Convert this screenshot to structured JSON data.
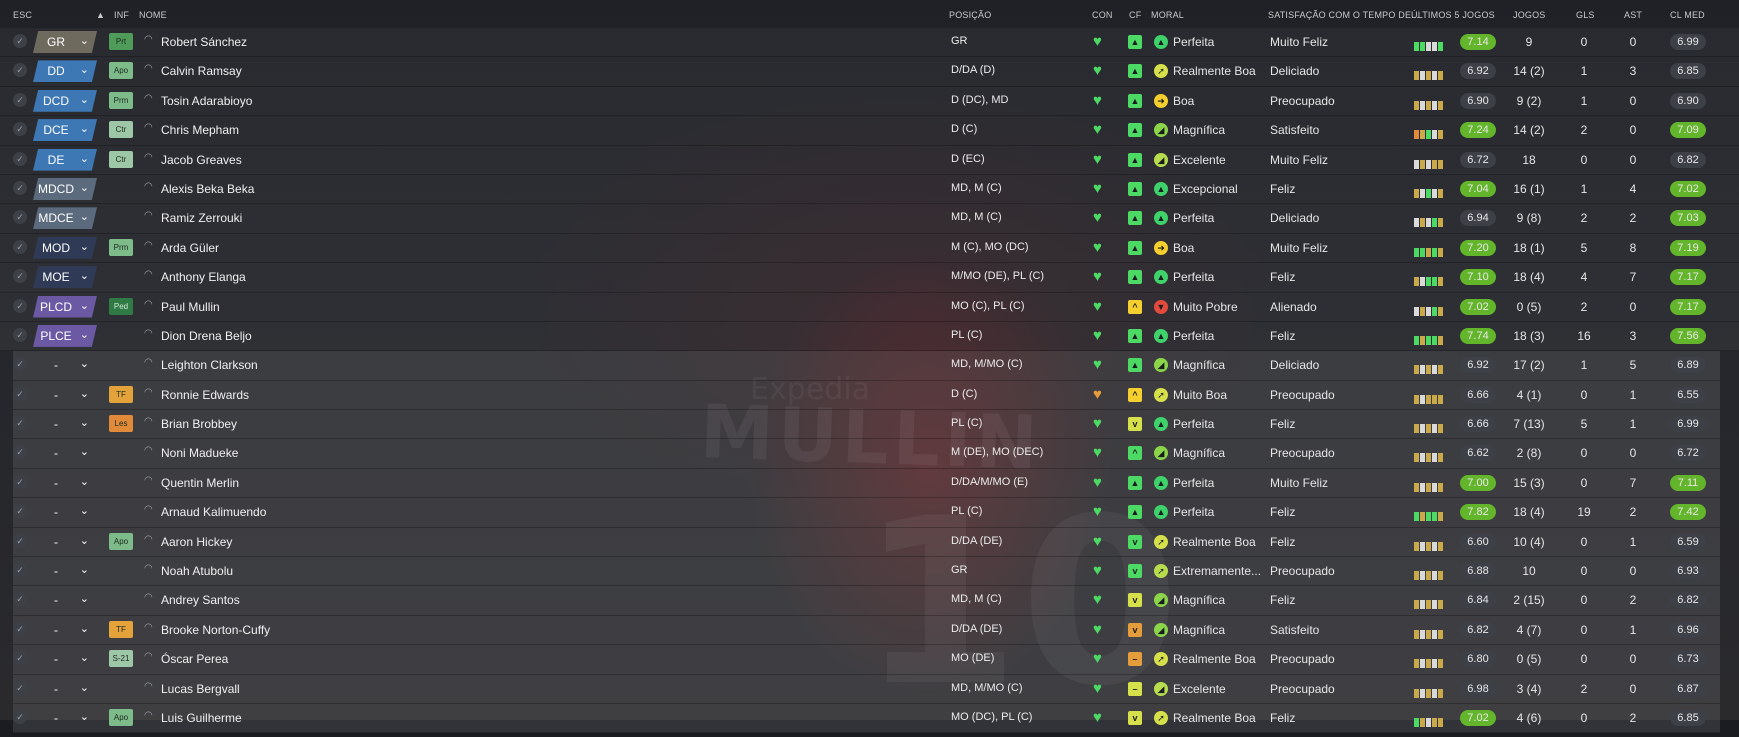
{
  "headers": {
    "esc": "ESC",
    "inf": "INF",
    "nome": "NOME",
    "posicao": "POSIÇÃO",
    "con": "CON",
    "cf": "CF",
    "moral": "MORAL",
    "satisfacao": "SATISFAÇÃO COM O TEMPO DE...",
    "ultimos": "ÚLTIMOS 5 JOGOS",
    "jogos": "JOGOS",
    "gls": "GLS",
    "ast": "AST",
    "clmed": "CL MED"
  },
  "background_text": {
    "shirt_name": "MULLIN",
    "shirt_number": "10",
    "sponsor": "Expedia"
  },
  "colors": {
    "gk": "#6f6a5e",
    "def": "#3d78b5",
    "mid": "#5b6b7d",
    "dm": "#2f3b56",
    "att": "#6b5aa3",
    "rating_high": "#63b52b",
    "rating_low": "#3d4047",
    "heart": "#4cd964",
    "heart_warn": "#e59c3a"
  },
  "players": [
    {
      "pos": "GR",
      "pcol": "gk",
      "inf": "Prt",
      "infc": "#4f9c5a",
      "name": "Robert Sánchez",
      "posicao": "GR",
      "heart": "ok",
      "cf": "▲",
      "cfc": "#4cd964",
      "mico": "▲",
      "mc": "#3fd16a",
      "moral": "Perfeita",
      "sat": "Muito Feliz",
      "bars": [
        "#4cd964",
        "#4cd964",
        "#d9d9d9",
        "#d9d9d9",
        "#4cd964"
      ],
      "rating": "7.14",
      "rh": true,
      "jogos": "9",
      "gls": "0",
      "ast": "0",
      "cl": "6.99",
      "ch": false
    },
    {
      "pos": "DD",
      "pcol": "def",
      "inf": "Apo",
      "infc": "#7dbb8a",
      "name": "Calvin Ramsay",
      "posicao": "D/DA (D)",
      "heart": "ok",
      "cf": "▲",
      "cfc": "#4cd964",
      "mico": "➚",
      "mc": "#d6e04a",
      "moral": "Realmente Boa",
      "sat": "Deliciado",
      "bars": [
        "#c9a94a",
        "#d9d9d9",
        "#c9a94a",
        "#d9d9d9",
        "#c9a94a"
      ],
      "rating": "6.92",
      "rh": false,
      "jogos": "14 (2)",
      "gls": "1",
      "ast": "3",
      "cl": "6.85",
      "ch": false
    },
    {
      "pos": "DCD",
      "pcol": "def",
      "inf": "Prm",
      "infc": "#7dbb8a",
      "name": "Tosin Adarabioyo",
      "posicao": "D (DC), MD",
      "heart": "ok",
      "cf": "▲",
      "cfc": "#4cd964",
      "mico": "➜",
      "mc": "#f4cf2d",
      "moral": "Boa",
      "sat": "Preocupado",
      "bars": [
        "#c9a94a",
        "#d9d9d9",
        "#c9a94a",
        "#d9d9d9",
        "#c9a94a"
      ],
      "rating": "6.90",
      "rh": false,
      "jogos": "9 (2)",
      "gls": "1",
      "ast": "0",
      "cl": "6.90",
      "ch": false
    },
    {
      "pos": "DCE",
      "pcol": "def",
      "inf": "Ctr",
      "infc": "#9ec7a7",
      "name": "Chris Mepham",
      "posicao": "D (C)",
      "heart": "ok",
      "cf": "▲",
      "cfc": "#4cd964",
      "mico": "◢",
      "mc": "#8bd54a",
      "moral": "Magnífica",
      "sat": "Satisfeito",
      "bars": [
        "#e08a3a",
        "#c9a94a",
        "#4cd964",
        "#d9d9d9",
        "#c9a94a"
      ],
      "rating": "7.24",
      "rh": true,
      "jogos": "14 (2)",
      "gls": "2",
      "ast": "0",
      "cl": "7.09",
      "ch": true
    },
    {
      "pos": "DE",
      "pcol": "def",
      "inf": "Ctr",
      "infc": "#9ec7a7",
      "name": "Jacob Greaves",
      "posicao": "D (EC)",
      "heart": "ok",
      "cf": "▲",
      "cfc": "#4cd964",
      "mico": "◢",
      "mc": "#b7dd4e",
      "moral": "Excelente",
      "sat": "Muito Feliz",
      "bars": [
        "#d9d9d9",
        "#c9a94a",
        "#d9d9d9",
        "#c9a94a",
        "#c9a94a"
      ],
      "rating": "6.72",
      "rh": false,
      "jogos": "18",
      "gls": "0",
      "ast": "0",
      "cl": "6.82",
      "ch": false
    },
    {
      "pos": "MDCD",
      "pcol": "mid",
      "inf": "",
      "infc": "",
      "name": "Alexis Beka Beka",
      "posicao": "MD, M (C)",
      "heart": "ok",
      "cf": "▲",
      "cfc": "#4cd964",
      "mico": "▲",
      "mc": "#3fd16a",
      "moral": "Excepcional",
      "sat": "Feliz",
      "bars": [
        "#c9a94a",
        "#d9d9d9",
        "#4cd964",
        "#d9d9d9",
        "#c9a94a"
      ],
      "rating": "7.04",
      "rh": true,
      "jogos": "16 (1)",
      "gls": "1",
      "ast": "4",
      "cl": "7.02",
      "ch": true
    },
    {
      "pos": "MDCE",
      "pcol": "mid",
      "inf": "",
      "infc": "",
      "name": "Ramiz Zerrouki",
      "posicao": "MD, M (C)",
      "heart": "ok",
      "cf": "▲",
      "cfc": "#4cd964",
      "mico": "▲",
      "mc": "#3fd16a",
      "moral": "Perfeita",
      "sat": "Deliciado",
      "bars": [
        "#d9d9d9",
        "#c9a94a",
        "#d9d9d9",
        "#4cd964",
        "#c9a94a"
      ],
      "rating": "6.94",
      "rh": false,
      "jogos": "9 (8)",
      "gls": "2",
      "ast": "2",
      "cl": "7.03",
      "ch": true
    },
    {
      "pos": "MOD",
      "pcol": "dm",
      "inf": "Prm",
      "infc": "#7dbb8a",
      "name": "Arda Güler",
      "posicao": "M (C), MO (DC)",
      "heart": "ok",
      "cf": "▲",
      "cfc": "#4cd964",
      "mico": "➜",
      "mc": "#f4cf2d",
      "moral": "Boa",
      "sat": "Muito Feliz",
      "bars": [
        "#4cd964",
        "#4cd964",
        "#c9a94a",
        "#4cd964",
        "#c9a94a"
      ],
      "rating": "7.20",
      "rh": true,
      "jogos": "18 (1)",
      "gls": "5",
      "ast": "8",
      "cl": "7.19",
      "ch": true
    },
    {
      "pos": "MOE",
      "pcol": "dm",
      "inf": "",
      "infc": "",
      "name": "Anthony Elanga",
      "posicao": "M/MO (DE), PL (C)",
      "heart": "ok",
      "cf": "▲",
      "cfc": "#4cd964",
      "mico": "▲",
      "mc": "#3fd16a",
      "moral": "Perfeita",
      "sat": "Feliz",
      "bars": [
        "#c9a94a",
        "#d9d9d9",
        "#4cd964",
        "#4cd964",
        "#c9a94a"
      ],
      "rating": "7.10",
      "rh": true,
      "jogos": "18 (4)",
      "gls": "4",
      "ast": "7",
      "cl": "7.17",
      "ch": true
    },
    {
      "pos": "PLCD",
      "pcol": "att",
      "inf": "Ped",
      "infc": "#2f7a45",
      "name": "Paul Mullin",
      "posicao": "MO (C), PL (C)",
      "heart": "ok",
      "cf": "^",
      "cfc": "#f4cf2d",
      "mico": "▼",
      "mc": "#e24a3b",
      "moral": "Muito Pobre",
      "sat": "Alienado",
      "bars": [
        "#d9d9d9",
        "#c9a94a",
        "#d9d9d9",
        "#4cd964",
        "#c9a94a"
      ],
      "rating": "7.02",
      "rh": true,
      "jogos": "0 (5)",
      "gls": "2",
      "ast": "0",
      "cl": "7.17",
      "ch": true
    },
    {
      "pos": "PLCE",
      "pcol": "att",
      "inf": "",
      "infc": "",
      "name": "Dion Drena Beljo",
      "posicao": "PL (C)",
      "heart": "ok",
      "cf": "▲",
      "cfc": "#4cd964",
      "mico": "▲",
      "mc": "#3fd16a",
      "moral": "Perfeita",
      "sat": "Feliz",
      "bars": [
        "#4cd964",
        "#c9a94a",
        "#4cd964",
        "#4cd964",
        "#c9a94a"
      ],
      "rating": "7.74",
      "rh": true,
      "jogos": "18 (3)",
      "gls": "16",
      "ast": "3",
      "cl": "7.56",
      "ch": true
    },
    {
      "pos": "-",
      "pcol": "none",
      "inf": "",
      "infc": "",
      "name": "Leighton Clarkson",
      "posicao": "MD, M/MO (C)",
      "heart": "ok",
      "cf": "▲",
      "cfc": "#4cd964",
      "mico": "◢",
      "mc": "#8bd54a",
      "moral": "Magnífica",
      "sat": "Deliciado",
      "bars": [
        "#c9a94a",
        "#d9d9d9",
        "#c9a94a",
        "#d9d9d9",
        "#c9a94a"
      ],
      "rating": "6.92",
      "rh": false,
      "jogos": "17 (2)",
      "gls": "1",
      "ast": "5",
      "cl": "6.89",
      "ch": false
    },
    {
      "pos": "-",
      "pcol": "none",
      "inf": "TF",
      "infc": "#e3a33a",
      "name": "Ronnie Edwards",
      "posicao": "D (C)",
      "heart": "warn",
      "cf": "^",
      "cfc": "#f4cf2d",
      "mico": "➚",
      "mc": "#d6e04a",
      "moral": "Muito Boa",
      "sat": "Preocupado",
      "bars": [
        "#c9a94a",
        "#d9d9d9",
        "#c9a94a",
        "#c9a94a",
        "#c9a94a"
      ],
      "rating": "6.66",
      "rh": false,
      "jogos": "4 (1)",
      "gls": "0",
      "ast": "1",
      "cl": "6.55",
      "ch": false
    },
    {
      "pos": "-",
      "pcol": "none",
      "inf": "Les",
      "infc": "#e08a3a",
      "name": "Brian Brobbey",
      "posicao": "PL (C)",
      "heart": "ok",
      "cf": "v",
      "cfc": "#d6e04a",
      "mico": "▲",
      "mc": "#3fd16a",
      "moral": "Perfeita",
      "sat": "Feliz",
      "bars": [
        "#c9a94a",
        "#d9d9d9",
        "#c9a94a",
        "#d9d9d9",
        "#c9a94a"
      ],
      "rating": "6.66",
      "rh": false,
      "jogos": "7 (13)",
      "gls": "5",
      "ast": "1",
      "cl": "6.99",
      "ch": false
    },
    {
      "pos": "-",
      "pcol": "none",
      "inf": "",
      "infc": "",
      "name": "Noni Madueke",
      "posicao": "M (DE), MO (DEC)",
      "heart": "ok",
      "cf": "^",
      "cfc": "#4cd964",
      "mico": "◢",
      "mc": "#8bd54a",
      "moral": "Magnífica",
      "sat": "Preocupado",
      "bars": [
        "#c9a94a",
        "#d9d9d9",
        "#c9a94a",
        "#d9d9d9",
        "#c9a94a"
      ],
      "rating": "6.62",
      "rh": false,
      "jogos": "2 (8)",
      "gls": "0",
      "ast": "0",
      "cl": "6.72",
      "ch": false
    },
    {
      "pos": "-",
      "pcol": "none",
      "inf": "",
      "infc": "",
      "name": "Quentin Merlin",
      "posicao": "D/DA/M/MO (E)",
      "heart": "ok",
      "cf": "▲",
      "cfc": "#4cd964",
      "mico": "▲",
      "mc": "#3fd16a",
      "moral": "Perfeita",
      "sat": "Muito Feliz",
      "bars": [
        "#c9a94a",
        "#d9d9d9",
        "#c9a94a",
        "#d9d9d9",
        "#c9a94a"
      ],
      "rating": "7.00",
      "rh": true,
      "jogos": "15 (3)",
      "gls": "0",
      "ast": "7",
      "cl": "7.11",
      "ch": true
    },
    {
      "pos": "-",
      "pcol": "none",
      "inf": "",
      "infc": "",
      "name": "Arnaud Kalimuendo",
      "posicao": "PL (C)",
      "heart": "ok",
      "cf": "▲",
      "cfc": "#4cd964",
      "mico": "▲",
      "mc": "#3fd16a",
      "moral": "Perfeita",
      "sat": "Feliz",
      "bars": [
        "#4cd964",
        "#c9a94a",
        "#4cd964",
        "#4cd964",
        "#c9a94a"
      ],
      "rating": "7.82",
      "rh": true,
      "jogos": "18 (4)",
      "gls": "19",
      "ast": "2",
      "cl": "7.42",
      "ch": true
    },
    {
      "pos": "-",
      "pcol": "none",
      "inf": "Apo",
      "infc": "#7dbb8a",
      "name": "Aaron Hickey",
      "posicao": "D/DA (DE)",
      "heart": "ok",
      "cf": "v",
      "cfc": "#4cd964",
      "mico": "➚",
      "mc": "#d6e04a",
      "moral": "Realmente Boa",
      "sat": "Feliz",
      "bars": [
        "#c9a94a",
        "#d9d9d9",
        "#c9a94a",
        "#d9d9d9",
        "#c9a94a"
      ],
      "rating": "6.60",
      "rh": false,
      "jogos": "10 (4)",
      "gls": "0",
      "ast": "1",
      "cl": "6.59",
      "ch": false
    },
    {
      "pos": "-",
      "pcol": "none",
      "inf": "",
      "infc": "",
      "name": "Noah Atubolu",
      "posicao": "GR",
      "heart": "ok",
      "cf": "v",
      "cfc": "#4cd964",
      "mico": "➚",
      "mc": "#b7dd4e",
      "moral": "Extremamente...",
      "sat": "Preocupado",
      "bars": [
        "#c9a94a",
        "#d9d9d9",
        "#c9a94a",
        "#d9d9d9",
        "#c9a94a"
      ],
      "rating": "6.88",
      "rh": false,
      "jogos": "10",
      "gls": "0",
      "ast": "0",
      "cl": "6.93",
      "ch": false
    },
    {
      "pos": "-",
      "pcol": "none",
      "inf": "",
      "infc": "",
      "name": "Andrey Santos",
      "posicao": "MD, M (C)",
      "heart": "ok",
      "cf": "v",
      "cfc": "#d6e04a",
      "mico": "◢",
      "mc": "#8bd54a",
      "moral": "Magnífica",
      "sat": "Feliz",
      "bars": [
        "#c9a94a",
        "#d9d9d9",
        "#c9a94a",
        "#d9d9d9",
        "#c9a94a"
      ],
      "rating": "6.84",
      "rh": false,
      "jogos": "2 (15)",
      "gls": "0",
      "ast": "2",
      "cl": "6.82",
      "ch": false
    },
    {
      "pos": "-",
      "pcol": "none",
      "inf": "TF",
      "infc": "#e3a33a",
      "name": "Brooke Norton-Cuffy",
      "posicao": "D/DA (DE)",
      "heart": "ok",
      "cf": "v",
      "cfc": "#e59c3a",
      "mico": "◢",
      "mc": "#8bd54a",
      "moral": "Magnífica",
      "sat": "Satisfeito",
      "bars": [
        "#c9a94a",
        "#d9d9d9",
        "#c9a94a",
        "#d9d9d9",
        "#c9a94a"
      ],
      "rating": "6.82",
      "rh": false,
      "jogos": "4 (7)",
      "gls": "0",
      "ast": "1",
      "cl": "6.96",
      "ch": false
    },
    {
      "pos": "-",
      "pcol": "none",
      "inf": "S-21",
      "infc": "#9ec7a7",
      "name": "Óscar Perea",
      "posicao": "MO (DE)",
      "heart": "ok",
      "cf": "–",
      "cfc": "#e59c3a",
      "mico": "➚",
      "mc": "#d6e04a",
      "moral": "Realmente Boa",
      "sat": "Preocupado",
      "bars": [
        "#c9a94a",
        "#d9d9d9",
        "#c9a94a",
        "#d9d9d9",
        "#c9a94a"
      ],
      "rating": "6.80",
      "rh": false,
      "jogos": "0 (5)",
      "gls": "0",
      "ast": "0",
      "cl": "6.73",
      "ch": false
    },
    {
      "pos": "-",
      "pcol": "none",
      "inf": "",
      "infc": "",
      "name": "Lucas Bergvall",
      "posicao": "MD, M/MO (C)",
      "heart": "ok",
      "cf": "–",
      "cfc": "#d6e04a",
      "mico": "◢",
      "mc": "#b7dd4e",
      "moral": "Excelente",
      "sat": "Preocupado",
      "bars": [
        "#c9a94a",
        "#d9d9d9",
        "#c9a94a",
        "#d9d9d9",
        "#c9a94a"
      ],
      "rating": "6.98",
      "rh": false,
      "jogos": "3 (4)",
      "gls": "2",
      "ast": "0",
      "cl": "6.87",
      "ch": false
    },
    {
      "pos": "-",
      "pcol": "none",
      "inf": "Apo",
      "infc": "#7dbb8a",
      "name": "Luis Guilherme",
      "posicao": "MO (DC), PL (C)",
      "heart": "ok",
      "cf": "v",
      "cfc": "#d6e04a",
      "mico": "➚",
      "mc": "#d6e04a",
      "moral": "Realmente Boa",
      "sat": "Feliz",
      "bars": [
        "#4cd964",
        "#c9a94a",
        "#d9d9d9",
        "#c9a94a",
        "#c9a94a"
      ],
      "rating": "7.02",
      "rh": true,
      "jogos": "4 (6)",
      "gls": "0",
      "ast": "2",
      "cl": "6.85",
      "ch": false
    }
  ]
}
